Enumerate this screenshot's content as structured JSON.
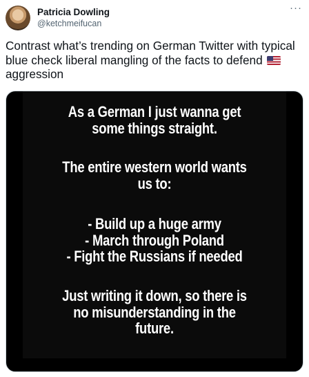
{
  "author": {
    "name": "Patricia Dowling",
    "handle": "@ketchmeifucan"
  },
  "menu": {
    "more_icon": "···"
  },
  "tweet": {
    "text_before_flag": "Contrast what’s trending on German Twitter with typical blue check liberal mangling of the facts to defend",
    "flag_icon": "us-flag-icon",
    "text_after_flag": "aggression"
  },
  "image": {
    "paragraph1": [
      "As a German I just wanna get",
      "some things straight."
    ],
    "paragraph2": [
      "The entire western world wants",
      "us to:"
    ],
    "paragraph3": [
      "- Build up a huge army",
      "- March through Poland",
      "- Fight the Russians if needed"
    ],
    "paragraph4": [
      "Just writing it down, so there is",
      "no misunderstanding in the",
      "future."
    ]
  }
}
